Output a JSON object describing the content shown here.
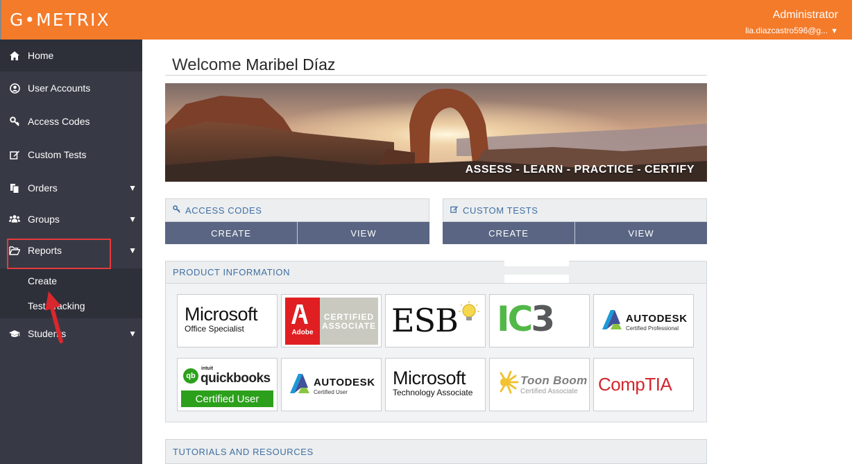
{
  "header": {
    "logo": "G•METRIX",
    "role": "Administrator",
    "email": "lia.diazcastro596@g...",
    "email_caret": "▼"
  },
  "sidebar": {
    "items": [
      {
        "label": "Home",
        "icon": "home-icon"
      },
      {
        "label": "User Accounts",
        "icon": "user-circle-icon"
      },
      {
        "label": "Access Codes",
        "icon": "key-icon"
      },
      {
        "label": "Custom Tests",
        "icon": "edit-icon"
      },
      {
        "label": "Orders",
        "icon": "documents-icon",
        "caret": "▼"
      },
      {
        "label": "Groups",
        "icon": "users-icon",
        "caret": "▼"
      },
      {
        "label": "Reports",
        "icon": "folder-open-icon",
        "caret": "▼"
      },
      {
        "label": "Students",
        "icon": "graduation-cap-icon",
        "caret": "▼"
      }
    ],
    "reports_sub": [
      "Create",
      "Test Tracking"
    ]
  },
  "main": {
    "welcome_prefix": "Welcome",
    "welcome_name": "Maribel Díaz",
    "banner_caption": "ASSESS  -  LEARN  -  PRACTICE  -  CERTIFY",
    "access_codes": {
      "title": "ACCESS CODES",
      "create": "CREATE",
      "view": "VIEW"
    },
    "custom_tests": {
      "title": "CUSTOM TESTS",
      "create": "CREATE",
      "view": "VIEW"
    },
    "product_info_title": "PRODUCT INFORMATION",
    "tutorials_title": "TUTORIALS AND RESOURCES"
  },
  "products": {
    "mos": {
      "big": "Microsoft",
      "small": "Office Specialist"
    },
    "aca": {
      "red": "Adobe",
      "grey": "CERTIFIED ASSOCIATE"
    },
    "esb": {
      "text": "ESB"
    },
    "ic3": {
      "text": "IC3"
    },
    "acp": {
      "word": "AUTODESK",
      "sub": "Certified Professional"
    },
    "qb": {
      "intuit": "intuit",
      "word": "quickbooks",
      "bar": "Certified User",
      "circle": "qb"
    },
    "acu": {
      "word": "AUTODESK",
      "sub": "Certified User"
    },
    "mta": {
      "big": "Microsoft",
      "small": "Technology Associate"
    },
    "toon": {
      "word": "Toon Boom",
      "sub": "Certified Associate"
    },
    "comptia": {
      "text": "CompTIA"
    }
  },
  "colors": {
    "header": "#f47b2a",
    "sidebar": "#373a45",
    "button": "#596583",
    "highlight": "#e8393c",
    "link": "#3f6fa3"
  }
}
